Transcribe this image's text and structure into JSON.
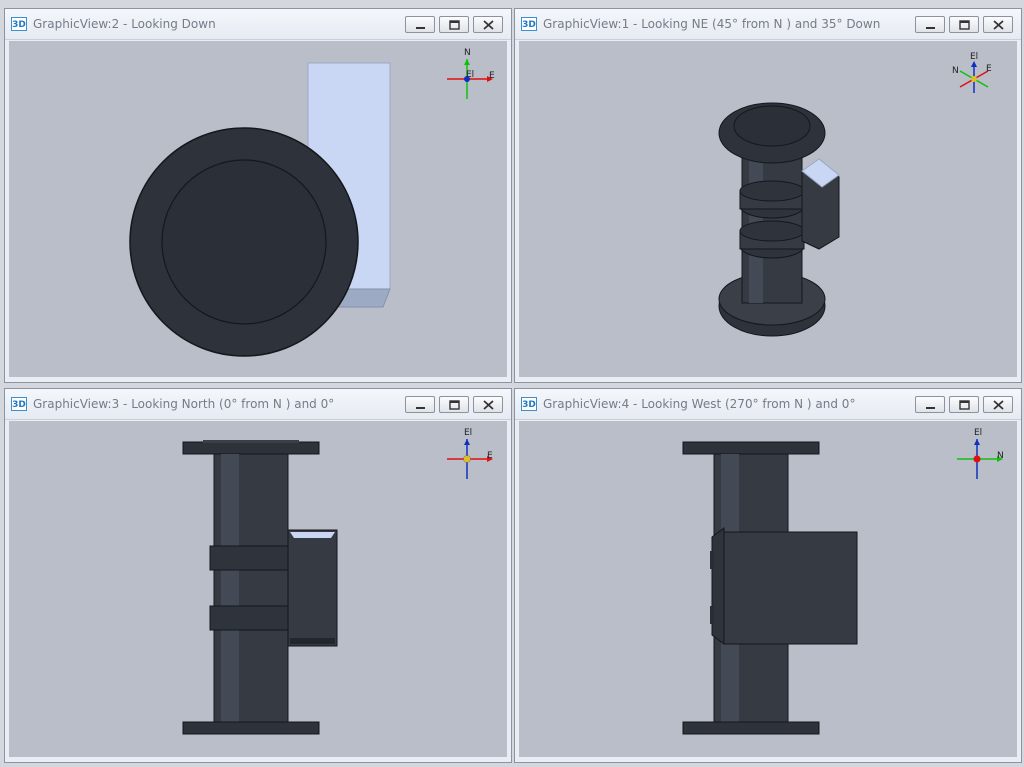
{
  "views": [
    {
      "title": "GraphicView:2 - Looking Down",
      "icon_label": "3D",
      "compass": {
        "up": "N",
        "right": "E",
        "center": "El"
      }
    },
    {
      "title": "GraphicView:1 - Looking NE (45° from N ) and 35° Down",
      "icon_label": "3D",
      "compass": {
        "up": "El",
        "left": "N",
        "right": "E"
      }
    },
    {
      "title": "GraphicView:3 - Looking North (0° from N ) and 0°",
      "icon_label": "3D",
      "compass": {
        "up": "El",
        "right": "E"
      }
    },
    {
      "title": "GraphicView:4 - Looking West (270° from N ) and 0°",
      "icon_label": "3D",
      "compass": {
        "up": "El",
        "right": "N"
      }
    }
  ],
  "window_buttons": [
    "minimize-icon",
    "restore-icon",
    "close-icon"
  ],
  "colors": {
    "viewport_bg": "#b9bec9",
    "pipe_dark": "#2e323a",
    "pipe_mid": "#3d424c",
    "box_light": "#c9d7f4",
    "axis_red": "#e01010",
    "axis_green": "#10c010",
    "axis_blue": "#1030c0"
  }
}
